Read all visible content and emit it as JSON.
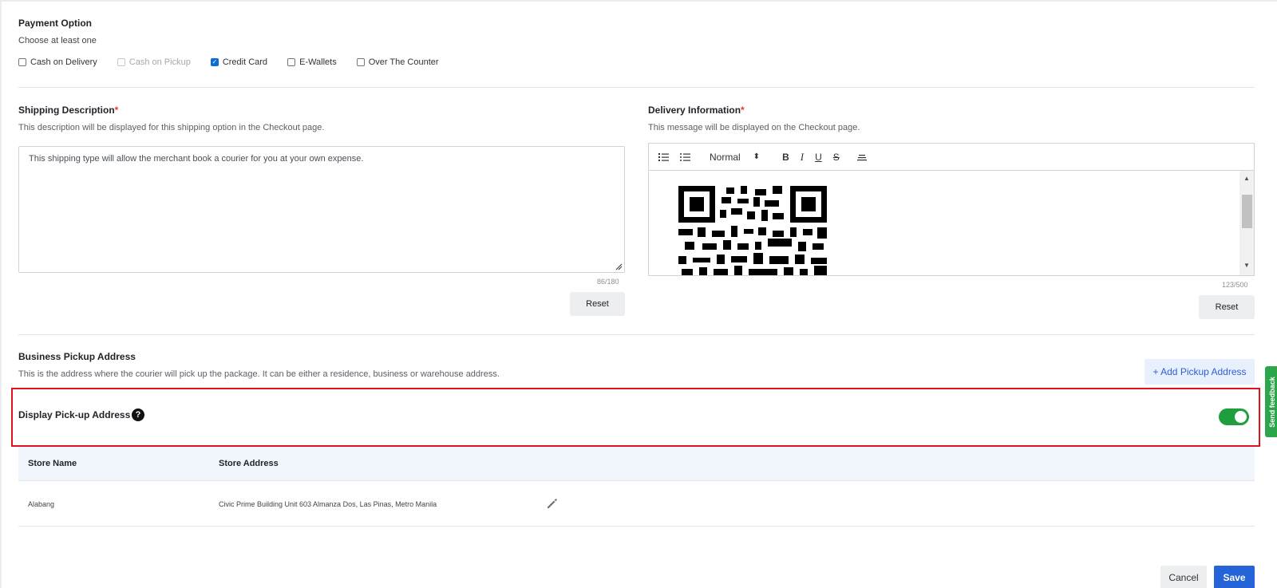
{
  "payment": {
    "title": "Payment Option",
    "subtitle": "Choose at least one",
    "options": [
      {
        "label": "Cash on Delivery",
        "checked": false,
        "disabled": false
      },
      {
        "label": "Cash on Pickup",
        "checked": false,
        "disabled": true
      },
      {
        "label": "Credit Card",
        "checked": true,
        "disabled": false
      },
      {
        "label": "E-Wallets",
        "checked": false,
        "disabled": false
      },
      {
        "label": "Over The Counter",
        "checked": false,
        "disabled": false
      }
    ]
  },
  "shipping": {
    "title": "Shipping Description",
    "required_mark": "*",
    "subtitle": "This description will be displayed for this shipping option in the Checkout page.",
    "value": "This shipping type will allow the merchant book a courier for you at your own expense.",
    "counter": "86/180",
    "reset_label": "Reset"
  },
  "delivery": {
    "title": "Delivery Information",
    "required_mark": "*",
    "subtitle": "This message will be displayed on the Checkout page.",
    "format_select": "Normal",
    "format_arrows": "⬍",
    "toolbar": {
      "bold": "B",
      "italic": "I",
      "underline": "U",
      "strike": "S"
    },
    "content_image": "qr-code",
    "counter": "123/500",
    "reset_label": "Reset"
  },
  "pickup": {
    "title": "Business Pickup Address",
    "subtitle": "This is the address where the courier will pick up the package. It can be either a residence, business or warehouse address.",
    "add_button": "+ Add Pickup Address",
    "display_label": "Display Pick-up Address",
    "help_glyph": "?",
    "display_enabled": true
  },
  "table": {
    "columns": [
      "Store Name",
      "Store Address"
    ],
    "rows": [
      {
        "name": "Alabang",
        "address": "Civic Prime Building Unit 603 Almanza Dos, Las Pinas, Metro Manila"
      }
    ]
  },
  "feedback_label": "Send feedback",
  "actions": {
    "cancel": "Cancel",
    "save": "Save"
  },
  "colors": {
    "primary": "#2563d8",
    "toggle_on": "#1e9e3c",
    "highlight": "#e0121c",
    "required": "#e53935"
  }
}
